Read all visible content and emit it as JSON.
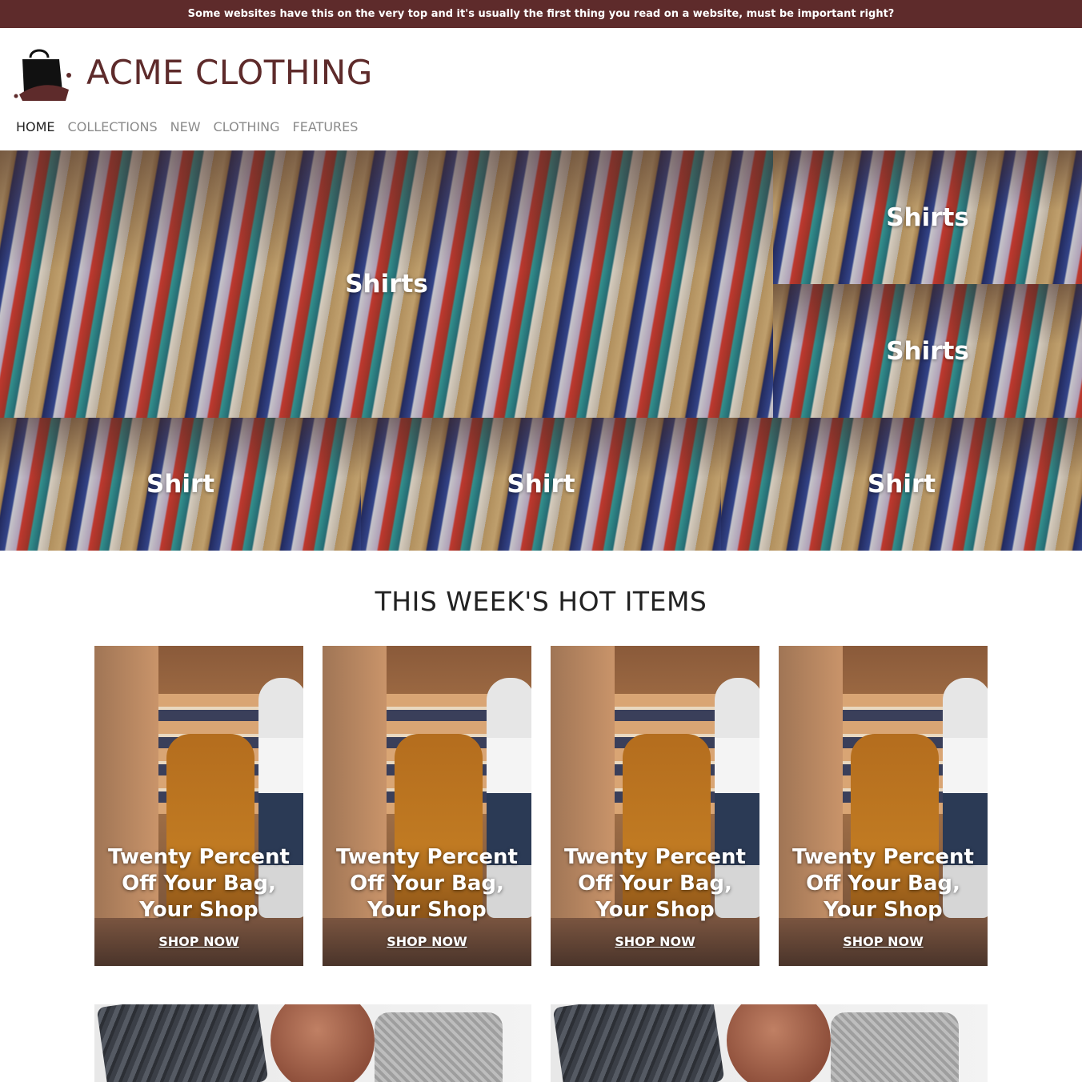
{
  "announcement": "Some websites have this on the very top and it's usually the first thing you read on a website, must be important right?",
  "brand": {
    "name": "ACME CLOTHING",
    "logo_icon": "shopping-bag-icon",
    "color": "#5e2b2b"
  },
  "nav": {
    "items": [
      {
        "label": "HOME",
        "active": true
      },
      {
        "label": "COLLECTIONS",
        "active": false
      },
      {
        "label": "NEW",
        "active": false
      },
      {
        "label": "CLOTHING",
        "active": false
      },
      {
        "label": "FEATURES",
        "active": false
      }
    ]
  },
  "hero": {
    "tiles": [
      {
        "label": "Shirts"
      },
      {
        "label": "Shirts"
      },
      {
        "label": "Shirts"
      },
      {
        "label": "Shirt"
      },
      {
        "label": "Shirt"
      },
      {
        "label": "Shirt"
      }
    ]
  },
  "hot_items": {
    "title": "THIS WEEK'S HOT ITEMS",
    "cards": [
      {
        "headline": "Twenty Percent Off Your Bag, Your Shop",
        "cta": "SHOP NOW"
      },
      {
        "headline": "Twenty Percent Off Your Bag, Your Shop",
        "cta": "SHOP NOW"
      },
      {
        "headline": "Twenty Percent Off Your Bag, Your Shop",
        "cta": "SHOP NOW"
      },
      {
        "headline": "Twenty Percent Off Your Bag, Your Shop",
        "cta": "SHOP NOW"
      }
    ]
  },
  "colors": {
    "accent": "#5e2b2b",
    "text": "#222222",
    "nav_inactive": "#8a8a8a"
  }
}
